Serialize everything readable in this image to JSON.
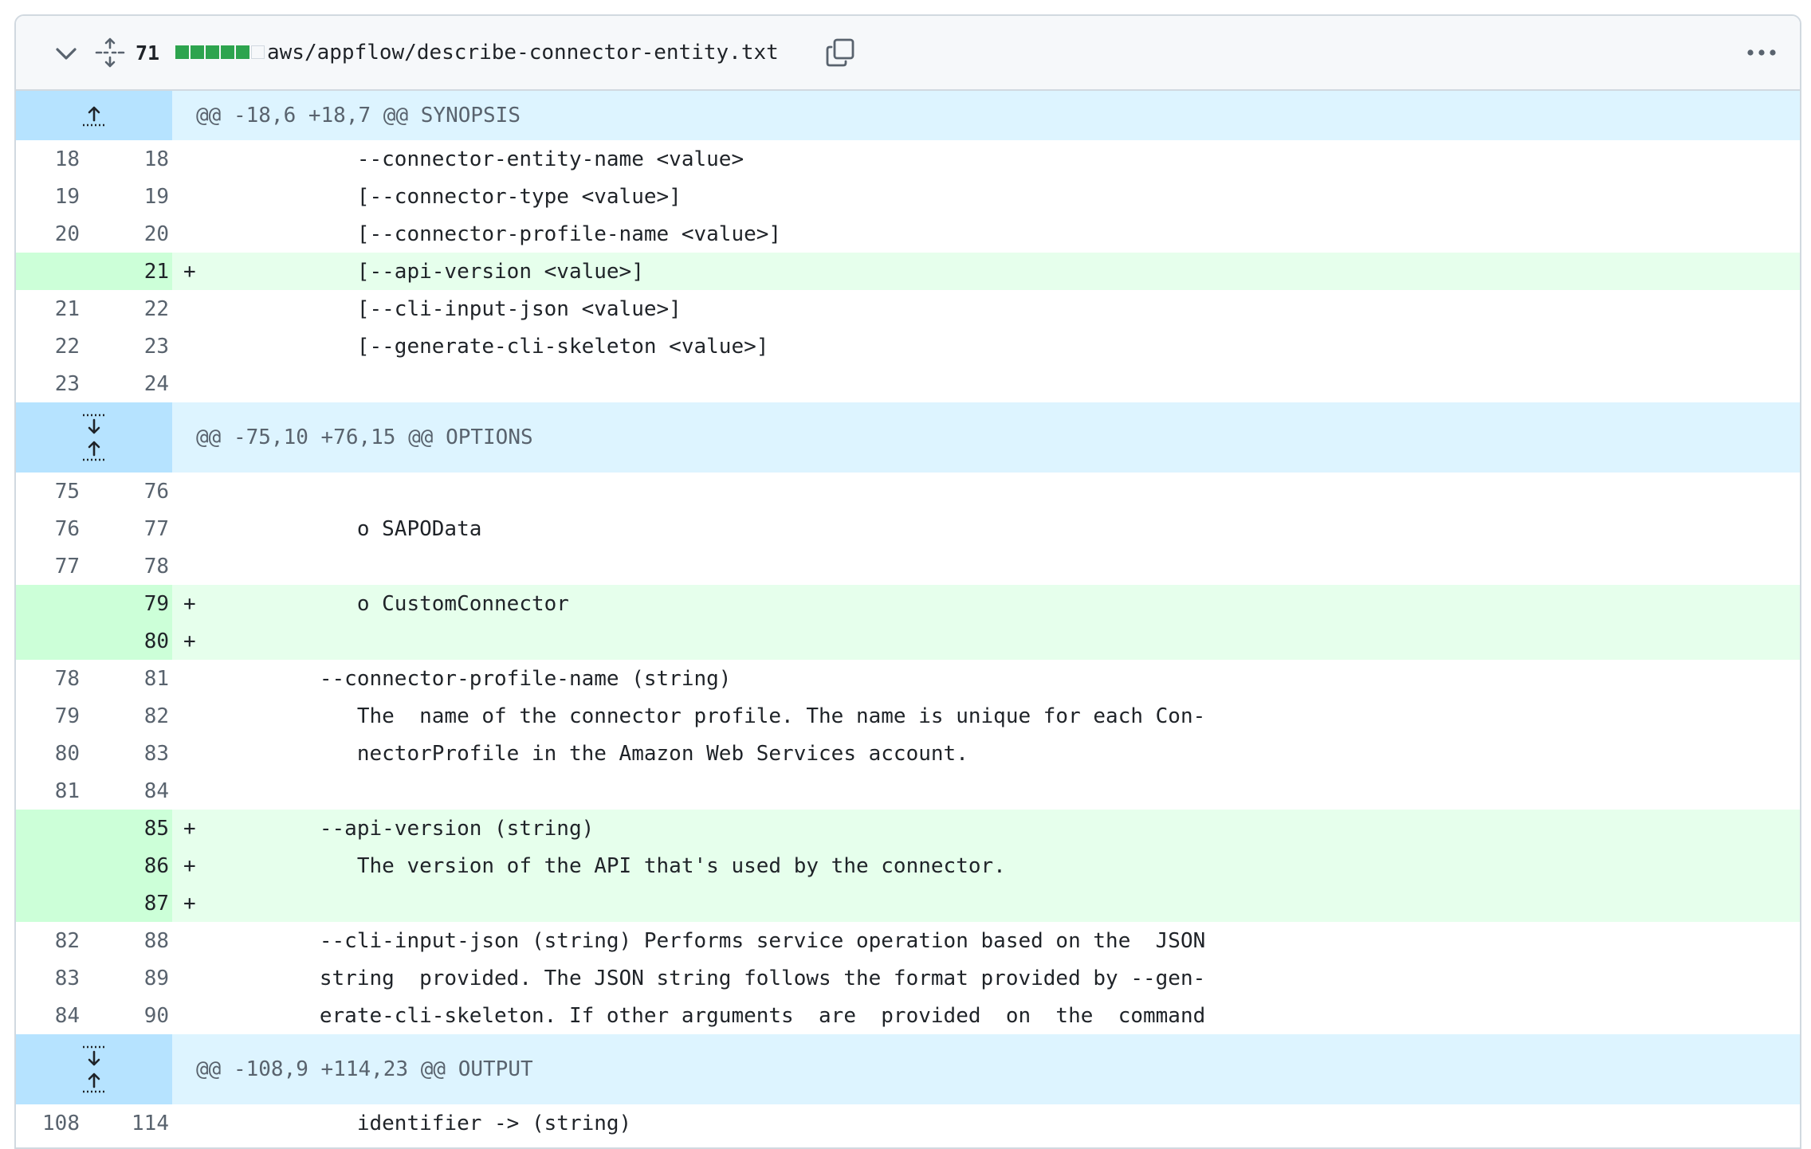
{
  "header": {
    "changes_count": "71",
    "filename": "aws/appflow/describe-connector-entity.txt",
    "diffstat": [
      "add",
      "add",
      "add",
      "add",
      "add",
      "neutral"
    ],
    "colors": {
      "add": "#2da44e",
      "neutral": "#d1d9e0"
    }
  },
  "rows": [
    {
      "type": "hunk",
      "text": "@@ -18,6 +18,7 @@ SYNOPSIS",
      "expand": "up"
    },
    {
      "type": "ctx",
      "old": "18",
      "new": "18",
      "marker": "",
      "text": "            --connector-entity-name <value>"
    },
    {
      "type": "ctx",
      "old": "19",
      "new": "19",
      "marker": "",
      "text": "            [--connector-type <value>]"
    },
    {
      "type": "ctx",
      "old": "20",
      "new": "20",
      "marker": "",
      "text": "            [--connector-profile-name <value>]"
    },
    {
      "type": "add",
      "old": "",
      "new": "21",
      "marker": "+",
      "text": "            [--api-version <value>]"
    },
    {
      "type": "ctx",
      "old": "21",
      "new": "22",
      "marker": "",
      "text": "            [--cli-input-json <value>]"
    },
    {
      "type": "ctx",
      "old": "22",
      "new": "23",
      "marker": "",
      "text": "            [--generate-cli-skeleton <value>]"
    },
    {
      "type": "ctx",
      "old": "23",
      "new": "24",
      "marker": "",
      "text": ""
    },
    {
      "type": "hunk",
      "text": "@@ -75,10 +76,15 @@ OPTIONS",
      "expand": "both"
    },
    {
      "type": "ctx",
      "old": "75",
      "new": "76",
      "marker": "",
      "text": ""
    },
    {
      "type": "ctx",
      "old": "76",
      "new": "77",
      "marker": "",
      "text": "            o SAPOData"
    },
    {
      "type": "ctx",
      "old": "77",
      "new": "78",
      "marker": "",
      "text": ""
    },
    {
      "type": "add",
      "old": "",
      "new": "79",
      "marker": "+",
      "text": "            o CustomConnector"
    },
    {
      "type": "add",
      "old": "",
      "new": "80",
      "marker": "+",
      "text": ""
    },
    {
      "type": "ctx",
      "old": "78",
      "new": "81",
      "marker": "",
      "text": "         --connector-profile-name (string)"
    },
    {
      "type": "ctx",
      "old": "79",
      "new": "82",
      "marker": "",
      "text": "            The  name of the connector profile. The name is unique for each Con-"
    },
    {
      "type": "ctx",
      "old": "80",
      "new": "83",
      "marker": "",
      "text": "            nectorProfile in the Amazon Web Services account."
    },
    {
      "type": "ctx",
      "old": "81",
      "new": "84",
      "marker": "",
      "text": ""
    },
    {
      "type": "add",
      "old": "",
      "new": "85",
      "marker": "+",
      "text": "         --api-version (string)"
    },
    {
      "type": "add",
      "old": "",
      "new": "86",
      "marker": "+",
      "text": "            The version of the API that's used by the connector."
    },
    {
      "type": "add",
      "old": "",
      "new": "87",
      "marker": "+",
      "text": ""
    },
    {
      "type": "ctx",
      "old": "82",
      "new": "88",
      "marker": "",
      "text": "         --cli-input-json (string) Performs service operation based on the  JSON"
    },
    {
      "type": "ctx",
      "old": "83",
      "new": "89",
      "marker": "",
      "text": "         string  provided. The JSON string follows the format provided by --gen-"
    },
    {
      "type": "ctx",
      "old": "84",
      "new": "90",
      "marker": "",
      "text": "         erate-cli-skeleton. If other arguments  are  provided  on  the  command"
    },
    {
      "type": "hunk",
      "text": "@@ -108,9 +114,23 @@ OUTPUT",
      "expand": "both"
    },
    {
      "type": "ctx",
      "old": "108",
      "new": "114",
      "marker": "",
      "text": "            identifier -> (string)"
    }
  ]
}
